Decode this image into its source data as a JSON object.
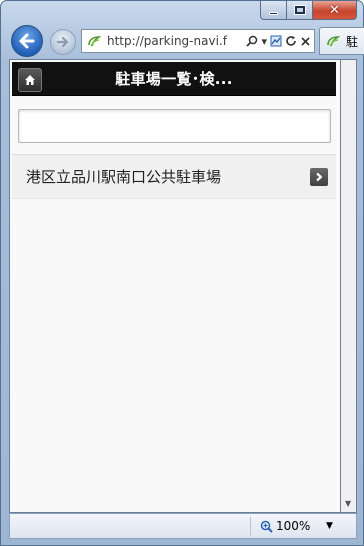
{
  "browser": {
    "url": "http://parking-navi.f",
    "tab_title": "駐",
    "zoom": "100%"
  },
  "page": {
    "title": "駐車場一覧･検...",
    "search": {
      "value": "",
      "placeholder": ""
    },
    "list_items": [
      {
        "label": "港区立品川駅南口公共駐車場"
      }
    ]
  },
  "colors": {
    "header_bg": "#111111",
    "list_bg": "#f0f0f0",
    "page_bg": "#f9f9f9",
    "accent_back": "#1f5fb8"
  },
  "icons": {
    "home": "home-icon",
    "chevron": "chevron-right-icon",
    "back": "back-arrow-icon",
    "forward": "forward-arrow-icon"
  }
}
